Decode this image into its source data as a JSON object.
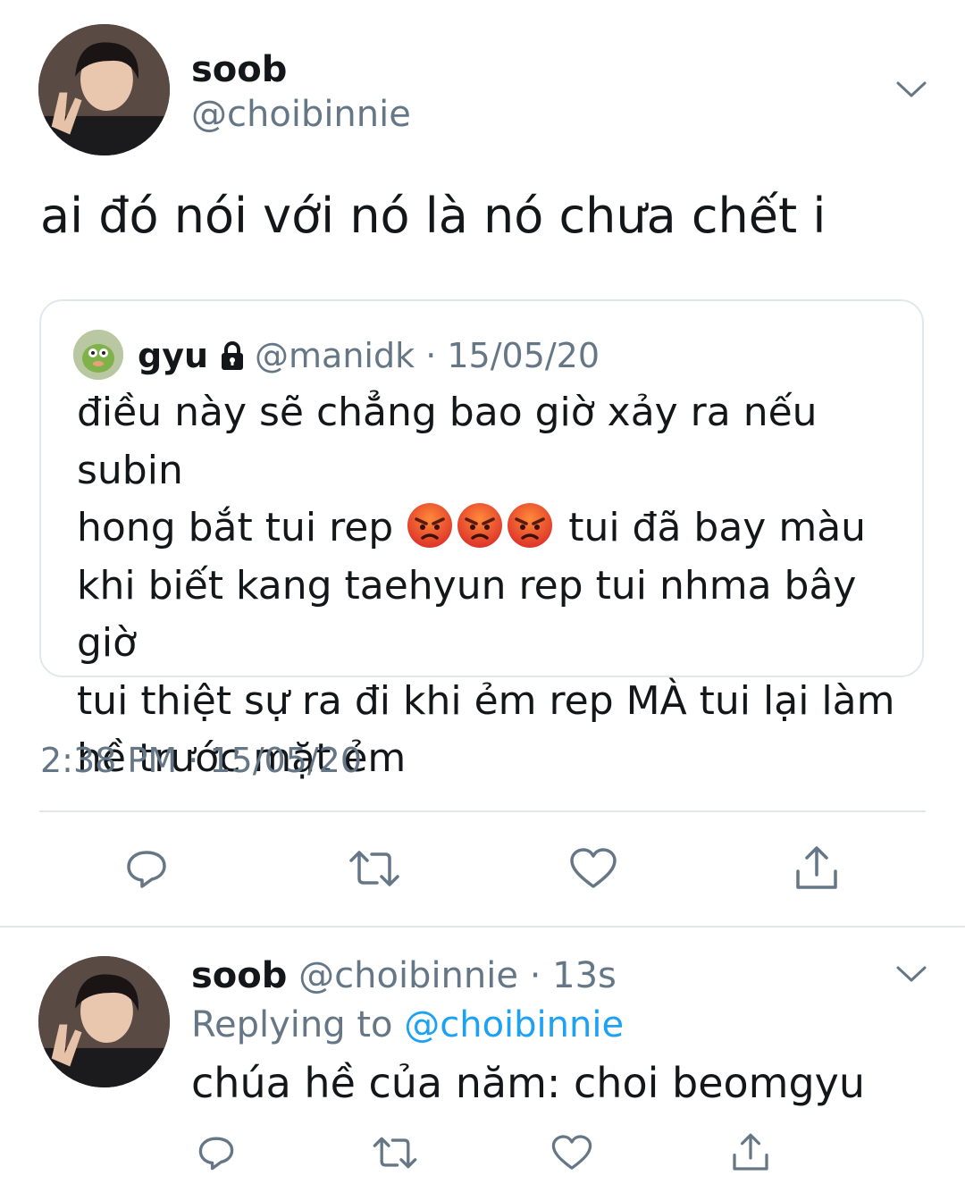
{
  "main_tweet": {
    "display_name": "soob",
    "handle": "@choibinnie",
    "avatar_icon": "profile-photo",
    "text": "ai đó nói với nó là nó chưa chết i",
    "timestamp": "2:38 PM · 15/05/20"
  },
  "quoted_tweet": {
    "display_name": "gyu",
    "lock_icon": "lock-icon",
    "handle": "@manidk",
    "separator": "·",
    "date": "15/05/20",
    "line1": "điều này sẽ chẳng bao giờ xảy ra nếu subin",
    "line2_before": "hong bắt tui rep ",
    "emoji": "angry-face",
    "emoji_count": 3,
    "line2_after": " tui đã bay màu",
    "line3": "khi biết kang taehyun rep tui nhma bây giờ",
    "line4": "tui thiệt sự ra đi khi ẻm rep MÀ tui lại làm",
    "line5": "hề trước mặt ẻm"
  },
  "actions": [
    "reply-icon",
    "retweet-icon",
    "like-icon",
    "share-icon"
  ],
  "reply_tweet": {
    "display_name": "soob",
    "handle": "@choibinnie",
    "separator": "·",
    "time": "13s",
    "replying_label": "Replying to",
    "replying_handle": "@choibinnie",
    "text": "chúa hề của năm: choi beomgyu"
  },
  "colors": {
    "text": "#14171a",
    "muted": "#657786",
    "link": "#1da1f2",
    "border": "#e1e8ed"
  }
}
